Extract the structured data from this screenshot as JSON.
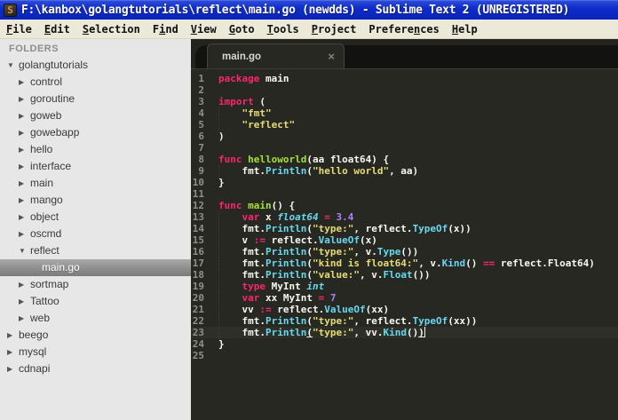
{
  "window": {
    "title": "F:\\kanbox\\golangtutorials\\reflect\\main.go (newdds) - Sublime Text 2 (UNREGISTERED)",
    "app_icon_letter": "S"
  },
  "menu": {
    "items": [
      {
        "label": "File",
        "accel": 0
      },
      {
        "label": "Edit",
        "accel": 0
      },
      {
        "label": "Selection",
        "accel": 0
      },
      {
        "label": "Find",
        "accel": 1
      },
      {
        "label": "View",
        "accel": 0
      },
      {
        "label": "Goto",
        "accel": 0
      },
      {
        "label": "Tools",
        "accel": 0
      },
      {
        "label": "Project",
        "accel": 0
      },
      {
        "label": "Preferences",
        "accel": 7
      },
      {
        "label": "Help",
        "accel": 0
      }
    ]
  },
  "sidebar": {
    "header": "FOLDERS",
    "items": [
      {
        "label": "golangtutorials",
        "level": 0,
        "state": "expanded"
      },
      {
        "label": "control",
        "level": 1,
        "state": "collapsed"
      },
      {
        "label": "goroutine",
        "level": 1,
        "state": "collapsed"
      },
      {
        "label": "goweb",
        "level": 1,
        "state": "collapsed"
      },
      {
        "label": "gowebapp",
        "level": 1,
        "state": "collapsed"
      },
      {
        "label": "hello",
        "level": 1,
        "state": "collapsed"
      },
      {
        "label": "interface",
        "level": 1,
        "state": "collapsed"
      },
      {
        "label": "main",
        "level": 1,
        "state": "collapsed"
      },
      {
        "label": "mango",
        "level": 1,
        "state": "collapsed"
      },
      {
        "label": "object",
        "level": 1,
        "state": "collapsed"
      },
      {
        "label": "oscmd",
        "level": 1,
        "state": "collapsed"
      },
      {
        "label": "reflect",
        "level": 1,
        "state": "expanded"
      },
      {
        "label": "main.go",
        "level": 2,
        "state": "file",
        "selected": true
      },
      {
        "label": "sortmap",
        "level": 1,
        "state": "collapsed"
      },
      {
        "label": "Tattoo",
        "level": 1,
        "state": "collapsed"
      },
      {
        "label": "web",
        "level": 1,
        "state": "collapsed"
      },
      {
        "label": "beego",
        "level": 0,
        "state": "collapsed"
      },
      {
        "label": "mysql",
        "level": 0,
        "state": "collapsed"
      },
      {
        "label": "cdnapi",
        "level": 0,
        "state": "collapsed"
      }
    ]
  },
  "tabs": {
    "active": {
      "label": "main.go",
      "close": "×"
    }
  },
  "editor": {
    "lines": [
      {
        "n": 1,
        "tokens": [
          {
            "t": "package",
            "c": "k"
          },
          {
            "t": " main",
            "c": "p"
          }
        ]
      },
      {
        "n": 2,
        "tokens": []
      },
      {
        "n": 3,
        "tokens": [
          {
            "t": "import",
            "c": "k"
          },
          {
            "t": " (",
            "c": "p"
          }
        ]
      },
      {
        "n": 4,
        "g": true,
        "tokens": [
          {
            "t": "    ",
            "c": "p"
          },
          {
            "t": "\"fmt\"",
            "c": "s"
          }
        ]
      },
      {
        "n": 5,
        "g": true,
        "tokens": [
          {
            "t": "    ",
            "c": "p"
          },
          {
            "t": "\"reflect\"",
            "c": "s"
          }
        ]
      },
      {
        "n": 6,
        "tokens": [
          {
            "t": ")",
            "c": "p"
          }
        ]
      },
      {
        "n": 7,
        "tokens": []
      },
      {
        "n": 8,
        "tokens": [
          {
            "t": "func",
            "c": "k"
          },
          {
            "t": " ",
            "c": "p"
          },
          {
            "t": "helloworld",
            "c": "f"
          },
          {
            "t": "(aa float64) {",
            "c": "p"
          }
        ]
      },
      {
        "n": 9,
        "g": true,
        "tokens": [
          {
            "t": "    fmt.",
            "c": "p"
          },
          {
            "t": "Println",
            "c": "c"
          },
          {
            "t": "(",
            "c": "p"
          },
          {
            "t": "\"hello world\"",
            "c": "s"
          },
          {
            "t": ", aa)",
            "c": "p"
          }
        ]
      },
      {
        "n": 10,
        "tokens": [
          {
            "t": "}",
            "c": "p"
          }
        ]
      },
      {
        "n": 11,
        "tokens": []
      },
      {
        "n": 12,
        "tokens": [
          {
            "t": "func",
            "c": "k"
          },
          {
            "t": " ",
            "c": "p"
          },
          {
            "t": "main",
            "c": "f"
          },
          {
            "t": "() {",
            "c": "p"
          }
        ]
      },
      {
        "n": 13,
        "g": true,
        "tokens": [
          {
            "t": "    ",
            "c": "p"
          },
          {
            "t": "var",
            "c": "k"
          },
          {
            "t": " x ",
            "c": "p"
          },
          {
            "t": "float64",
            "c": "ci"
          },
          {
            "t": " ",
            "c": "p"
          },
          {
            "t": "=",
            "c": "k"
          },
          {
            "t": " ",
            "c": "p"
          },
          {
            "t": "3.4",
            "c": "n"
          }
        ]
      },
      {
        "n": 14,
        "g": true,
        "tokens": [
          {
            "t": "    fmt.",
            "c": "p"
          },
          {
            "t": "Println",
            "c": "c"
          },
          {
            "t": "(",
            "c": "p"
          },
          {
            "t": "\"type:\"",
            "c": "s"
          },
          {
            "t": ", reflect.",
            "c": "p"
          },
          {
            "t": "TypeOf",
            "c": "c"
          },
          {
            "t": "(x))",
            "c": "p"
          }
        ]
      },
      {
        "n": 15,
        "g": true,
        "tokens": [
          {
            "t": "    v ",
            "c": "p"
          },
          {
            "t": ":=",
            "c": "k"
          },
          {
            "t": " reflect.",
            "c": "p"
          },
          {
            "t": "ValueOf",
            "c": "c"
          },
          {
            "t": "(x)",
            "c": "p"
          }
        ]
      },
      {
        "n": 16,
        "g": true,
        "tokens": [
          {
            "t": "    fmt.",
            "c": "p"
          },
          {
            "t": "Println",
            "c": "c"
          },
          {
            "t": "(",
            "c": "p"
          },
          {
            "t": "\"type:\"",
            "c": "s"
          },
          {
            "t": ", v.",
            "c": "p"
          },
          {
            "t": "Type",
            "c": "c"
          },
          {
            "t": "())",
            "c": "p"
          }
        ]
      },
      {
        "n": 17,
        "g": true,
        "tokens": [
          {
            "t": "    fmt.",
            "c": "p"
          },
          {
            "t": "Println",
            "c": "c"
          },
          {
            "t": "(",
            "c": "p"
          },
          {
            "t": "\"kind is float64:\"",
            "c": "s"
          },
          {
            "t": ", v.",
            "c": "p"
          },
          {
            "t": "Kind",
            "c": "c"
          },
          {
            "t": "() ",
            "c": "p"
          },
          {
            "t": "==",
            "c": "k"
          },
          {
            "t": " reflect.Float64)",
            "c": "p"
          }
        ]
      },
      {
        "n": 18,
        "g": true,
        "tokens": [
          {
            "t": "    fmt.",
            "c": "p"
          },
          {
            "t": "Println",
            "c": "c"
          },
          {
            "t": "(",
            "c": "p"
          },
          {
            "t": "\"value:\"",
            "c": "s"
          },
          {
            "t": ", v.",
            "c": "p"
          },
          {
            "t": "Float",
            "c": "c"
          },
          {
            "t": "())",
            "c": "p"
          }
        ]
      },
      {
        "n": 19,
        "g": true,
        "tokens": [
          {
            "t": "    ",
            "c": "p"
          },
          {
            "t": "type",
            "c": "k"
          },
          {
            "t": " MyInt ",
            "c": "p"
          },
          {
            "t": "int",
            "c": "ci"
          }
        ]
      },
      {
        "n": 20,
        "g": true,
        "tokens": [
          {
            "t": "    ",
            "c": "p"
          },
          {
            "t": "var",
            "c": "k"
          },
          {
            "t": " xx MyInt ",
            "c": "p"
          },
          {
            "t": "=",
            "c": "k"
          },
          {
            "t": " ",
            "c": "p"
          },
          {
            "t": "7",
            "c": "n"
          }
        ]
      },
      {
        "n": 21,
        "g": true,
        "tokens": [
          {
            "t": "    vv ",
            "c": "p"
          },
          {
            "t": ":=",
            "c": "k"
          },
          {
            "t": " reflect.",
            "c": "p"
          },
          {
            "t": "ValueOf",
            "c": "c"
          },
          {
            "t": "(xx)",
            "c": "p"
          }
        ]
      },
      {
        "n": 22,
        "g": true,
        "tokens": [
          {
            "t": "    fmt.",
            "c": "p"
          },
          {
            "t": "Println",
            "c": "c"
          },
          {
            "t": "(",
            "c": "p"
          },
          {
            "t": "\"type:\"",
            "c": "s"
          },
          {
            "t": ", reflect.",
            "c": "p"
          },
          {
            "t": "TypeOf",
            "c": "c"
          },
          {
            "t": "(xx))",
            "c": "p"
          }
        ]
      },
      {
        "n": 23,
        "g": true,
        "current": true,
        "cursor": true,
        "tokens": [
          {
            "t": "    fmt.",
            "c": "p"
          },
          {
            "t": "Println",
            "c": "c"
          },
          {
            "t": "(",
            "c": "p",
            "u": 1
          },
          {
            "t": "\"type:\"",
            "c": "s"
          },
          {
            "t": ", vv.",
            "c": "p"
          },
          {
            "t": "Kind",
            "c": "c"
          },
          {
            "t": "()",
            "c": "p"
          },
          {
            "t": ")",
            "c": "p",
            "u": 1
          }
        ]
      },
      {
        "n": 24,
        "tokens": [
          {
            "t": "}",
            "c": "p"
          }
        ]
      },
      {
        "n": 25,
        "tokens": []
      }
    ]
  },
  "colors": {
    "titlebar_blue": "#0e2cc9",
    "menu_bg": "#ece9d8",
    "sidebar_bg": "#e7e7e7",
    "sidebar_selected_gray": "#8e8e8e",
    "editor_bg": "#272822",
    "current_line_bg": "#2e2f28",
    "keyword_pink": "#f92672",
    "string_yellow": "#e6db74",
    "call_cyan": "#66d9ef",
    "funcdef_green": "#a6e22e",
    "number_purple": "#ae81ff",
    "plain_white": "#f8f8f2",
    "line_number_gray": "#8f908a"
  }
}
